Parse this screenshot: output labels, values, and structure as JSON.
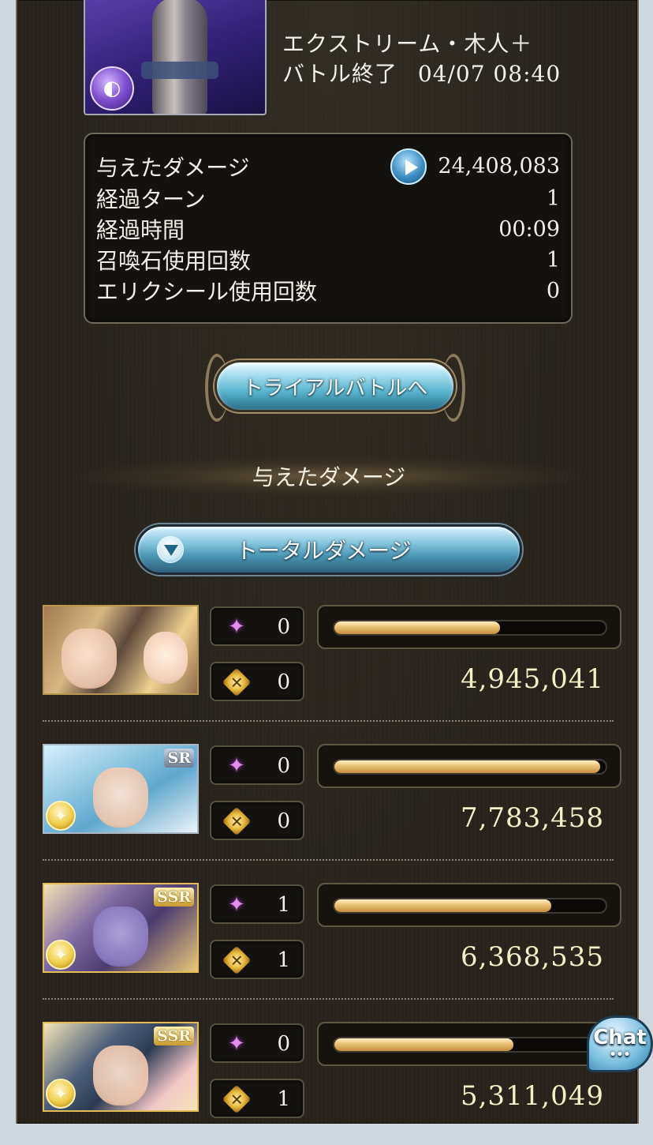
{
  "quest": {
    "title": "エクストリーム・木人＋",
    "status": "バトル終了",
    "datetime": "04/07 08:40",
    "element_icon": "dark-element-icon"
  },
  "stats": {
    "rows": [
      {
        "label": "与えたダメージ",
        "value": "24,408,083"
      },
      {
        "label": "経過ターン",
        "value": "1"
      },
      {
        "label": "経過時間",
        "value": "00:09"
      },
      {
        "label": "召喚石使用回数",
        "value": "1"
      },
      {
        "label": "エリクシール使用回数",
        "value": "0"
      }
    ]
  },
  "trial_button": {
    "label": "トライアルバトルへ"
  },
  "section": {
    "title": "与えたダメージ"
  },
  "dropdown": {
    "label": "トータルダメージ"
  },
  "characters": [
    {
      "rarity": "",
      "ability_count": "0",
      "chain_count": "0",
      "damage": "4,945,041",
      "bar_ratio": 0.61
    },
    {
      "rarity": "SR",
      "ability_count": "0",
      "chain_count": "0",
      "damage": "7,783,458",
      "bar_ratio": 0.98
    },
    {
      "rarity": "SSR",
      "ability_count": "1",
      "chain_count": "1",
      "damage": "6,368,535",
      "bar_ratio": 0.8
    },
    {
      "rarity": "SSR",
      "ability_count": "0",
      "chain_count": "1",
      "damage": "5,311,049",
      "bar_ratio": 0.66
    }
  ],
  "chat": {
    "label": "Chat",
    "dots": "•••"
  },
  "colors": {
    "frame_bg": "#27231c",
    "bar_gold": "#e8c174",
    "button_blue": "#5cb6d1"
  }
}
